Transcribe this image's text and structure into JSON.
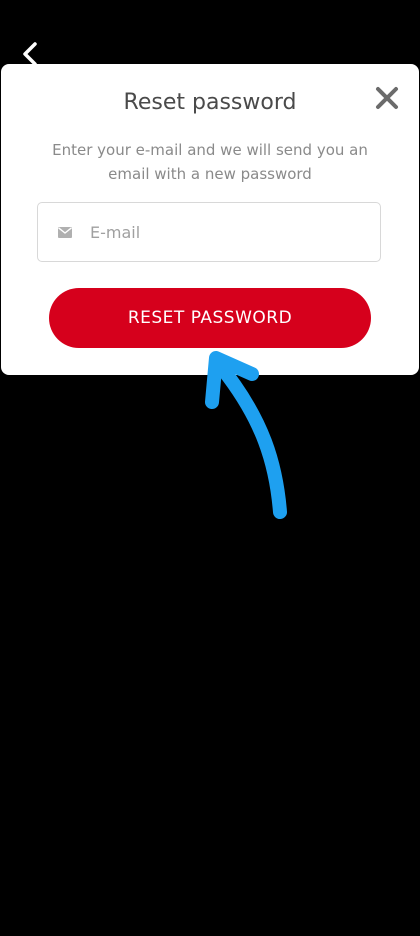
{
  "dialog": {
    "title": "Reset password",
    "description": "Enter your e-mail and we will send you an email with a new password",
    "email_placeholder": "E-mail",
    "email_value": "",
    "reset_label": "RESET PASSWORD"
  },
  "icons": {
    "back": "chevron-left-icon",
    "close": "close-icon",
    "email": "envelope-icon"
  },
  "colors": {
    "background": "#000000",
    "dialog": "#ffffff",
    "primary": "#d6001c",
    "annotation": "#1ea0f0"
  }
}
